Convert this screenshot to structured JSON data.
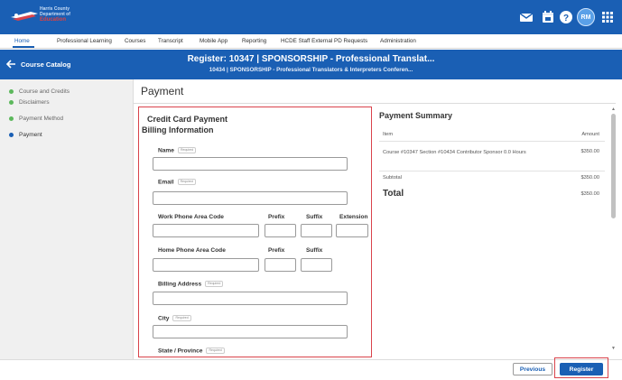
{
  "brand": {
    "line1": "Harris County",
    "line2": "Department of",
    "line3": "Education",
    "logo_icon": "flag-icon"
  },
  "topbar": {
    "icons": [
      "mail-icon",
      "calendar-icon",
      "help-icon",
      "apps-grid-icon"
    ],
    "avatar_initials": "RM"
  },
  "nav": {
    "items": [
      "Home",
      "Professional Learning",
      "Courses",
      "Transcript",
      "Mobile App",
      "Reporting",
      "HCDE Staff External PD Requests",
      "Administration"
    ],
    "active": "Home"
  },
  "header": {
    "back_label": "Course Catalog",
    "title": "Register: 10347 | SPONSORSHIP - Professional Translat...",
    "subtitle": "10434 | SPONSORSHIP - Professional Translators & Interpreters Conferen..."
  },
  "steps": [
    {
      "label": "Course and Credits",
      "status": "complete"
    },
    {
      "label": "Disclaimers",
      "status": "complete"
    },
    {
      "label": "Payment Method",
      "status": "complete"
    },
    {
      "label": "Payment",
      "status": "current"
    }
  ],
  "page_title": "Payment",
  "form": {
    "section_title": "Credit Card Payment",
    "subsection_title": "Billing Information",
    "required_tag": "Required",
    "fields": {
      "name": {
        "label": "Name",
        "value": ""
      },
      "email": {
        "label": "Email",
        "value": ""
      },
      "work_phone": {
        "area_label": "Work Phone Area Code",
        "prefix_label": "Prefix",
        "suffix_label": "Suffix",
        "extension_label": "Extension"
      },
      "home_phone": {
        "area_label": "Home Phone Area Code",
        "prefix_label": "Prefix",
        "suffix_label": "Suffix"
      },
      "billing_address": {
        "label": "Billing Address",
        "value": ""
      },
      "city": {
        "label": "City",
        "value": ""
      },
      "state": {
        "label": "State / Province"
      }
    }
  },
  "summary": {
    "title": "Payment Summary",
    "col_item": "Item",
    "col_amount": "Amount",
    "line_item": "Course #10347 Section #10434 Contributor Sponsor 0.0 Hours",
    "line_amount": "$350.00",
    "subtotal_label": "Subtotal",
    "subtotal_amount": "$350.00",
    "total_label": "Total",
    "total_amount": "$350.00"
  },
  "footer": {
    "previous_label": "Previous",
    "register_label": "Register"
  },
  "colors": {
    "primary": "#1a5fb4",
    "step_complete": "#5cb85c",
    "highlight": "#d9434b"
  }
}
